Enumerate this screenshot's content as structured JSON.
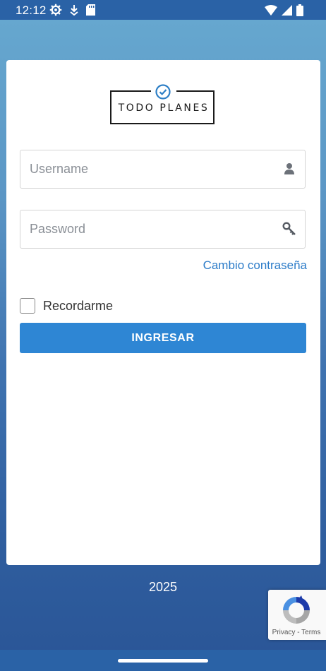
{
  "status_bar": {
    "time": "12:12",
    "icons_left": [
      "settings-icon",
      "download-icon",
      "sd-card-icon"
    ],
    "icons_right": [
      "wifi-icon",
      "signal-icon",
      "battery-icon"
    ]
  },
  "logo": {
    "text": "TODO PLANES",
    "check_color": "#2e7fc6"
  },
  "login": {
    "username_placeholder": "Username",
    "password_placeholder": "Password",
    "change_password_link": "Cambio contraseña",
    "remember_label": "Recordarme",
    "submit_label": "INGRESAR"
  },
  "footer": {
    "year": "2025"
  },
  "recaptcha": {
    "text": "Privacy - Terms"
  },
  "colors": {
    "accent": "#2e86d4",
    "link": "#2b7bc8",
    "status_bar": "#2a62a6"
  }
}
